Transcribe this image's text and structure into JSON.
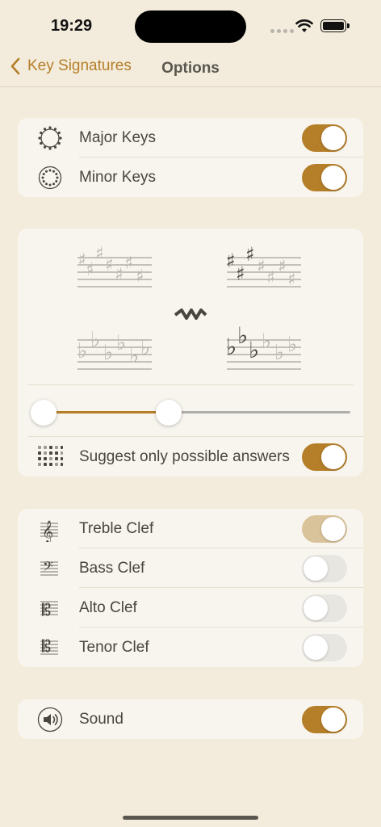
{
  "status": {
    "time": "19:29"
  },
  "nav": {
    "back_label": "Key Signatures",
    "title": "Options"
  },
  "keys": {
    "major_label": "Major Keys",
    "major_on": true,
    "minor_label": "Minor Keys",
    "minor_on": true
  },
  "difficulty": {
    "suggest_label": "Suggest only possible answers",
    "suggest_on": true,
    "range_low": 0.0,
    "range_high": 0.42
  },
  "clefs": {
    "treble_label": "Treble Clef",
    "treble_on": true,
    "bass_label": "Bass Clef",
    "bass_on": false,
    "alto_label": "Alto Clef",
    "alto_on": false,
    "tenor_label": "Tenor Clef",
    "tenor_on": false
  },
  "sound": {
    "label": "Sound",
    "on": true
  },
  "colors": {
    "accent": "#b57e29",
    "background": "#f3ecdc",
    "card": "#f8f5ee"
  }
}
